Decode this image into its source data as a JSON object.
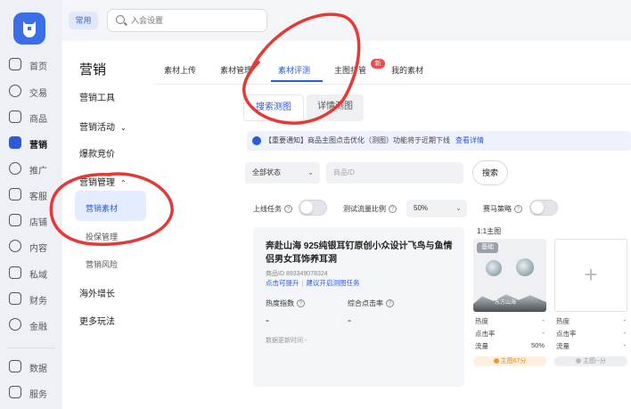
{
  "nav": {
    "items": [
      {
        "label": "首页",
        "icon": "home-icon"
      },
      {
        "label": "交易",
        "icon": "order-icon"
      },
      {
        "label": "商品",
        "icon": "bag-icon"
      },
      {
        "label": "营销",
        "icon": "megaphone-icon",
        "active": true
      },
      {
        "label": "推广",
        "icon": "pin-icon"
      },
      {
        "label": "客服",
        "icon": "headset-icon"
      },
      {
        "label": "店铺",
        "icon": "store-icon"
      },
      {
        "label": "内容",
        "icon": "content-icon"
      },
      {
        "label": "私域",
        "icon": "people-icon"
      },
      {
        "label": "财务",
        "icon": "wallet-icon"
      },
      {
        "label": "金融",
        "icon": "coin-icon"
      }
    ],
    "bottom_items": [
      {
        "label": "数据",
        "icon": "chart-icon"
      },
      {
        "label": "服务",
        "icon": "grid-icon"
      }
    ]
  },
  "topbar": {
    "pill": "常用",
    "search_placeholder": "入会设置"
  },
  "submenu": {
    "title": "营销",
    "items": [
      "营销工具",
      "营销活动",
      "爆款竞价",
      "营销管理",
      "营销素材",
      "投保管理",
      "营销风险",
      "海外增长",
      "更多玩法"
    ]
  },
  "tabs": [
    "素材上传",
    "素材管理",
    "素材评测",
    "主图打管",
    "我的素材"
  ],
  "tab_badge": "新",
  "segments": [
    "搜索测图",
    "详情测图"
  ],
  "notice": {
    "text": "【重要通知】商品主图点击优化（测图）功能将于近期下线",
    "link": "查看详情"
  },
  "filters": {
    "status": "全部状态",
    "id_placeholder": "商品ID",
    "search_button": "搜索"
  },
  "controls": {
    "launch_task": "上线任务",
    "traffic_ratio": "测试流量比例",
    "ratio_value": "50%",
    "horse_race": "赛马策略"
  },
  "product": {
    "title": "奔赴山海 925纯银耳钉原创小众设计飞鸟与鱼情侣男女耳饰养耳洞",
    "id_text": "商品ID 893349078324",
    "link1": "点击可提升",
    "link2": "建议开启测图任务",
    "metric1_label": "热度指数",
    "metric1_value": "-",
    "metric2_label": "综合点击率",
    "metric2_value": "-",
    "updated": "数据更新时间 -"
  },
  "material": {
    "header": "1:1主图",
    "chip": "基础",
    "watermark": "东方山海",
    "stats_a": [
      {
        "label": "热度",
        "value": "-"
      },
      {
        "label": "点击率",
        "value": "-"
      },
      {
        "label": "流量",
        "value": "50%"
      }
    ],
    "stats_b": [
      {
        "label": "热度",
        "value": "-"
      },
      {
        "label": "点击率",
        "value": "-"
      },
      {
        "label": "流量",
        "value": "-"
      }
    ],
    "foot_a": "主图67分",
    "foot_b": "主图--分"
  },
  "colors": {
    "accent": "#2d5bd8",
    "annotation": "#e53935"
  }
}
